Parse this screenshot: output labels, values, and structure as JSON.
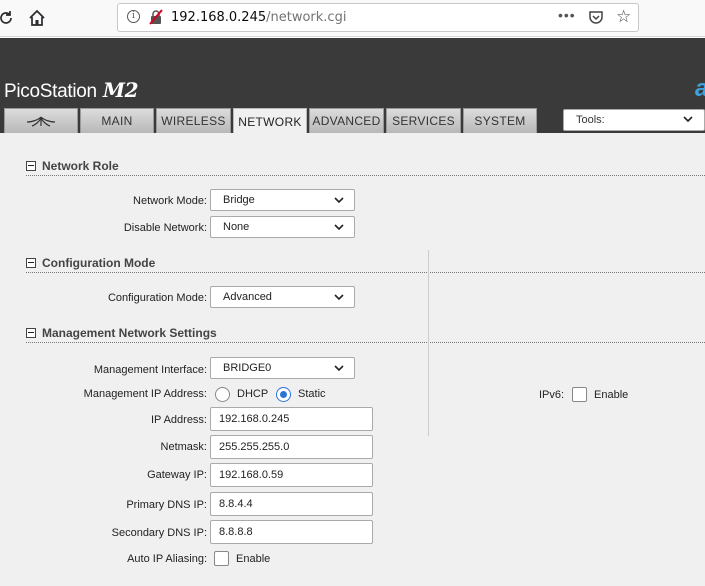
{
  "browser": {
    "url_host": "192.168.0.245",
    "url_path": "/network.cgi",
    "reload_icon": "reload-icon",
    "home_icon": "home-icon",
    "more_icon": "more-icon",
    "more_glyph": "•••"
  },
  "header": {
    "brand": "PicoStation",
    "brand_model": "M2"
  },
  "tabs": [
    {
      "label": "",
      "icon": "ubiquiti-logo-icon"
    },
    {
      "label": "MAIN"
    },
    {
      "label": "WIRELESS"
    },
    {
      "label": "NETWORK",
      "active": true
    },
    {
      "label": "ADVANCED"
    },
    {
      "label": "SERVICES"
    },
    {
      "label": "SYSTEM"
    }
  ],
  "tools": {
    "value": "Tools:"
  },
  "sections": {
    "network_role": {
      "title": "Network Role",
      "network_mode_label": "Network Mode:",
      "network_mode_value": "Bridge",
      "disable_network_label": "Disable Network:",
      "disable_network_value": "None"
    },
    "configuration_mode": {
      "title": "Configuration Mode",
      "configuration_mode_label": "Configuration Mode:",
      "configuration_mode_value": "Advanced"
    },
    "management": {
      "title": "Management Network Settings",
      "interface_label": "Management Interface:",
      "interface_value": "BRIDGE0",
      "ip_address_mode_label": "Management IP Address:",
      "dhcp_label": "DHCP",
      "static_label": "Static",
      "selected_mode": "Static",
      "ip_address_label": "IP Address:",
      "ip_address_value": "192.168.0.245",
      "netmask_label": "Netmask:",
      "netmask_value": "255.255.255.0",
      "gateway_label": "Gateway IP:",
      "gateway_value": "192.168.0.59",
      "primary_dns_label": "Primary DNS IP:",
      "primary_dns_value": "8.8.4.4",
      "secondary_dns_label": "Secondary DNS IP:",
      "secondary_dns_value": "8.8.8.8",
      "auto_ip_aliasing_label": "Auto IP Aliasing:",
      "auto_ip_aliasing_enable": "Enable",
      "ipv6_label": "IPv6:",
      "ipv6_enable": "Enable"
    }
  },
  "colors": {
    "header_bg": "#3a3a3a",
    "accent": "#2a74d8",
    "brand_blue": "#3ba4e0"
  }
}
